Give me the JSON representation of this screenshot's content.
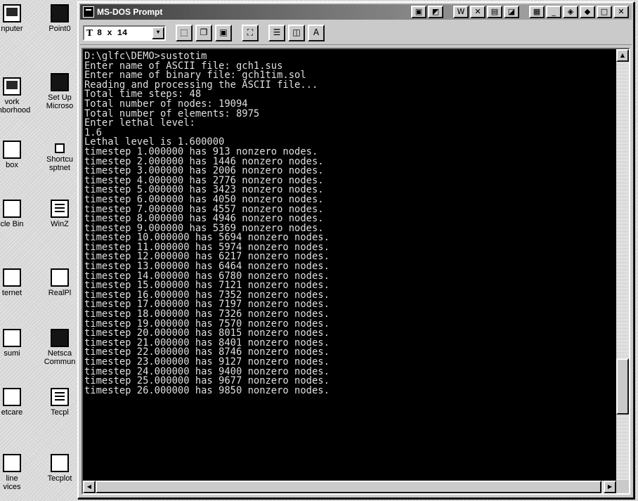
{
  "window": {
    "title": "MS-DOS Prompt",
    "font_size": "8 x 14",
    "font_prefix": "T"
  },
  "desktop_icons": [
    {
      "label": "nputer",
      "icon": "computer-icon"
    },
    {
      "label": "Point0",
      "icon": "application-icon"
    },
    {
      "label": "vork\nghborhood",
      "icon": "network-icon"
    },
    {
      "label": "Set Up\nMicroso",
      "icon": "setup-icon"
    },
    {
      "label": "box",
      "icon": "inbox-icon"
    },
    {
      "label": "Shortcu\nsptnet",
      "icon": "shortcut-icon"
    },
    {
      "label": "cle Bin",
      "icon": "recycle-bin-icon"
    },
    {
      "label": "WinZ",
      "icon": "winzip-icon"
    },
    {
      "label": "ternet",
      "icon": "internet-icon"
    },
    {
      "label": "RealPl",
      "icon": "realplayer-icon"
    },
    {
      "label": "sumi",
      "icon": "folder-icon"
    },
    {
      "label": "Netsca\nCommun",
      "icon": "netscape-icon"
    },
    {
      "label": "etcare",
      "icon": "program-icon"
    },
    {
      "label": "Tecpl",
      "icon": "tecplot-icon"
    },
    {
      "label": "line\nvices",
      "icon": "online-services-icon"
    },
    {
      "label": "Tecplot",
      "icon": "tecplot-icon"
    }
  ],
  "console_lines": [
    "D:\\glfc\\DEMO>sustotim",
    "Enter name of ASCII file: gch1.sus",
    "Enter name of binary file: gch1tim.sol",
    "Reading and processing the ASCII file...",
    "Total time steps: 48",
    "Total number of nodes: 19094",
    "Total number of elements: 8975",
    "Enter lethal level:",
    "1.6",
    "Lethal level is 1.600000",
    "timestep 1.000000 has 913 nonzero nodes.",
    "timestep 2.000000 has 1446 nonzero nodes.",
    "timestep 3.000000 has 2006 nonzero nodes.",
    "timestep 4.000000 has 2776 nonzero nodes.",
    "timestep 5.000000 has 3423 nonzero nodes.",
    "timestep 6.000000 has 4050 nonzero nodes.",
    "timestep 7.000000 has 4557 nonzero nodes.",
    "timestep 8.000000 has 4946 nonzero nodes.",
    "timestep 9.000000 has 5369 nonzero nodes.",
    "timestep 10.000000 has 5694 nonzero nodes.",
    "timestep 11.000000 has 5974 nonzero nodes.",
    "timestep 12.000000 has 6217 nonzero nodes.",
    "timestep 13.000000 has 6464 nonzero nodes.",
    "timestep 14.000000 has 6780 nonzero nodes.",
    "timestep 15.000000 has 7121 nonzero nodes.",
    "timestep 16.000000 has 7352 nonzero nodes.",
    "timestep 17.000000 has 7197 nonzero nodes.",
    "timestep 18.000000 has 7326 nonzero nodes.",
    "timestep 19.000000 has 7570 nonzero nodes.",
    "timestep 20.000000 has 8015 nonzero nodes.",
    "timestep 21.000000 has 8401 nonzero nodes.",
    "timestep 22.000000 has 8746 nonzero nodes.",
    "timestep 23.000000 has 9127 nonzero nodes.",
    "timestep 24.000000 has 9400 nonzero nodes.",
    "timestep 25.000000 has 9677 nonzero nodes.",
    "timestep 26.000000 has 9850 nonzero nodes."
  ],
  "colors": {
    "console_bg": "#000000",
    "console_text": "#d8d8d8",
    "window_face": "#c0c0c0"
  }
}
